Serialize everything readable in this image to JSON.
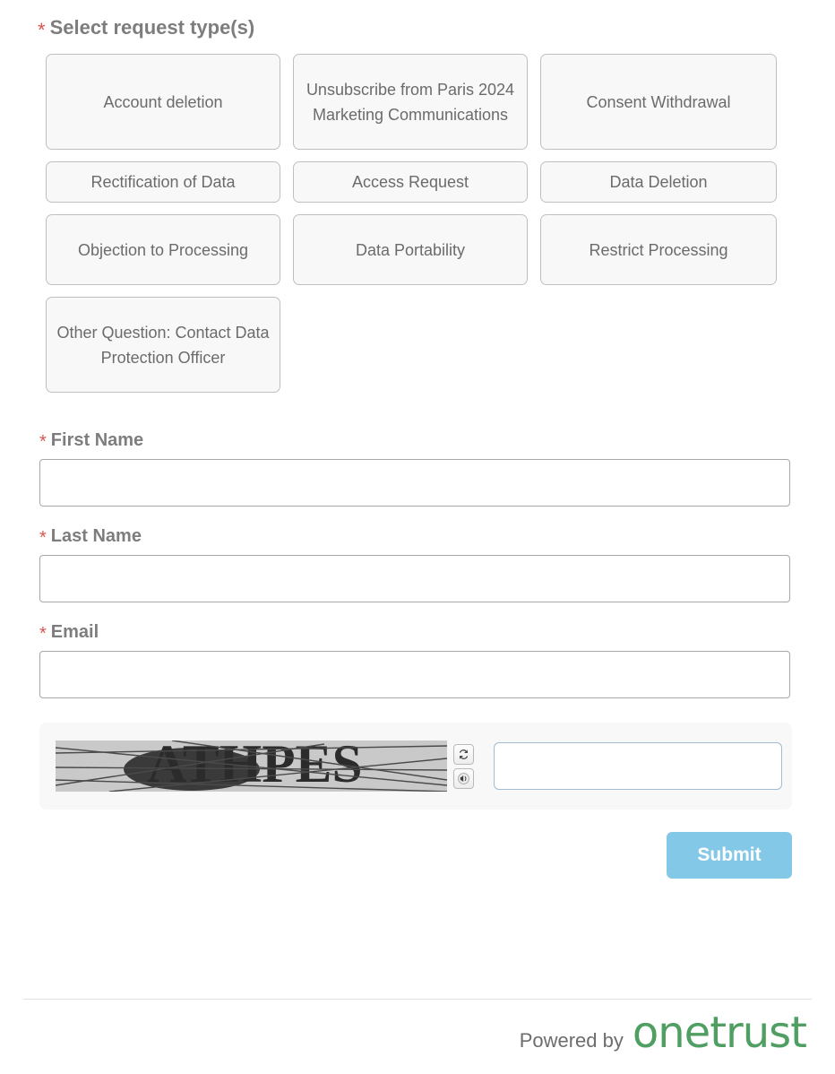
{
  "form": {
    "required_marker": "*",
    "section": {
      "heading": "Select request type(s)"
    },
    "request_types": [
      {
        "label": "Account deletion",
        "row": 1
      },
      {
        "label": "Unsubscribe from Paris 2024 Marketing Communications",
        "row": 1
      },
      {
        "label": "Consent Withdrawal",
        "row": 1
      },
      {
        "label": "Rectification of Data",
        "row": 2
      },
      {
        "label": "Access Request",
        "row": 2
      },
      {
        "label": "Data Deletion",
        "row": 2
      },
      {
        "label": "Objection to Processing",
        "row": 3
      },
      {
        "label": "Data Portability",
        "row": 3
      },
      {
        "label": "Restrict Processing",
        "row": 3
      },
      {
        "label": "Other Question: Contact Data Protection Officer",
        "row": 4
      }
    ],
    "fields": [
      {
        "label": "First Name",
        "value": "",
        "placeholder": ""
      },
      {
        "label": "Last Name",
        "value": "",
        "placeholder": ""
      },
      {
        "label": "Email",
        "value": "",
        "placeholder": ""
      }
    ],
    "captcha": {
      "text": "ATHPES",
      "input_value": "",
      "input_placeholder": "",
      "refresh_icon": "refresh-icon",
      "audio_icon": "speaker-icon"
    },
    "submit_label": "Submit"
  },
  "footer": {
    "powered_by": "Powered by",
    "brand": "onetrust"
  },
  "colors": {
    "accent_submit": "#84c8e8",
    "brand_green": "#4f9e62",
    "required_red": "#d9534f",
    "label_gray": "#7d7d7d",
    "button_fill": "#f8f8f8",
    "button_border": "#bfbfbf",
    "captcha_input_border": "#a4bad2"
  }
}
